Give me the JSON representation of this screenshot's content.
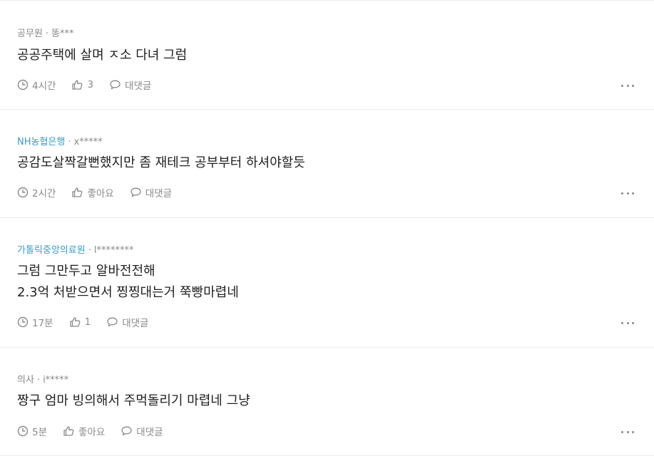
{
  "comments": [
    {
      "company": "공무원",
      "user": "똥***",
      "content_lines": [
        "공공주택에 살며 ㅈ소 다녀 그럼"
      ],
      "time": "4시간",
      "like_label": "3",
      "reply_label": "대댓글"
    },
    {
      "company": "NH농협은행",
      "user": "x*****",
      "content_lines": [
        "공감도살짝갈뻔했지만 좀 재테크 공부부터 하셔야할듯"
      ],
      "time": "2시간",
      "like_label": "좋아요",
      "reply_label": "대댓글"
    },
    {
      "company": "가톨릭중앙의료원",
      "user": "l********",
      "content_lines": [
        "그럼 그만두고 알바전전해",
        "2.3억 처받으면서 찡찡대는거 쭉빵마렵네"
      ],
      "time": "17분",
      "like_label": "1",
      "reply_label": "대댓글"
    },
    {
      "company": "의사",
      "user": "i*****",
      "content_lines": [
        "짱구 엄마 빙의해서 주먹돌리기 마렵네 그냥"
      ],
      "time": "5분",
      "like_label": "좋아요",
      "reply_label": "대댓글"
    }
  ],
  "meta_separator": "·",
  "colors": {
    "company_highlight": "#3a9bc2",
    "meta_gray": "#888888",
    "text": "#1f1f1f",
    "divider": "#ececec"
  }
}
